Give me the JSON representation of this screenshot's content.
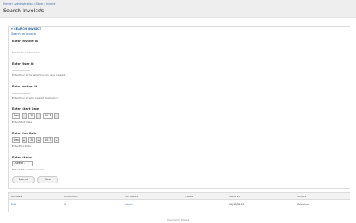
{
  "header": {
    "breadcrumb": "Home » Administration » Store » Invoice",
    "title": "Search Invoices",
    "add_icon": "plus-icon"
  },
  "form": {
    "legend": "▾ SEARCH INVOICE",
    "subtitle": "Search an invoice",
    "fields": {
      "invoice_id": {
        "label": "Enter Invoice Id",
        "value": "",
        "description": "Search by an Invoice Id"
      },
      "user_id": {
        "label": "Enter User Id",
        "value": "",
        "description": "Enter User Id for which Invoice was created."
      },
      "author_id": {
        "label": "Enter Author Id",
        "value": "",
        "description": "Enter User Id who created the Invoice."
      },
      "start_date": {
        "label": "Enter Start Date",
        "month": "Dec",
        "day": "31",
        "year": "2013",
        "description": "Enter Start Date"
      },
      "end_date": {
        "label": "Enter End Date",
        "month": "Dec",
        "day": "31",
        "year": "2013",
        "description": "Enter End Date"
      },
      "status": {
        "label": "Enter Status",
        "value": "- select -",
        "description": "Enter Status of the Invoice."
      }
    },
    "buttons": {
      "submit": "Submit",
      "clear": "Clear"
    }
  },
  "results": {
    "columns": [
      "ACTIONS",
      "INVOICE ID",
      "CUSTOMER",
      "TOTAL",
      "CREATED",
      "STATUS"
    ],
    "rows": [
      {
        "actions": "Edit",
        "invoice_id": "1",
        "customer": "admin",
        "total": "",
        "created": "06/13/2013",
        "status": "Complete"
      }
    ]
  },
  "footer": {
    "text": "Powered by Drupal"
  },
  "colors": {
    "link": "#2466a8",
    "topbar": "#eeeeee"
  }
}
